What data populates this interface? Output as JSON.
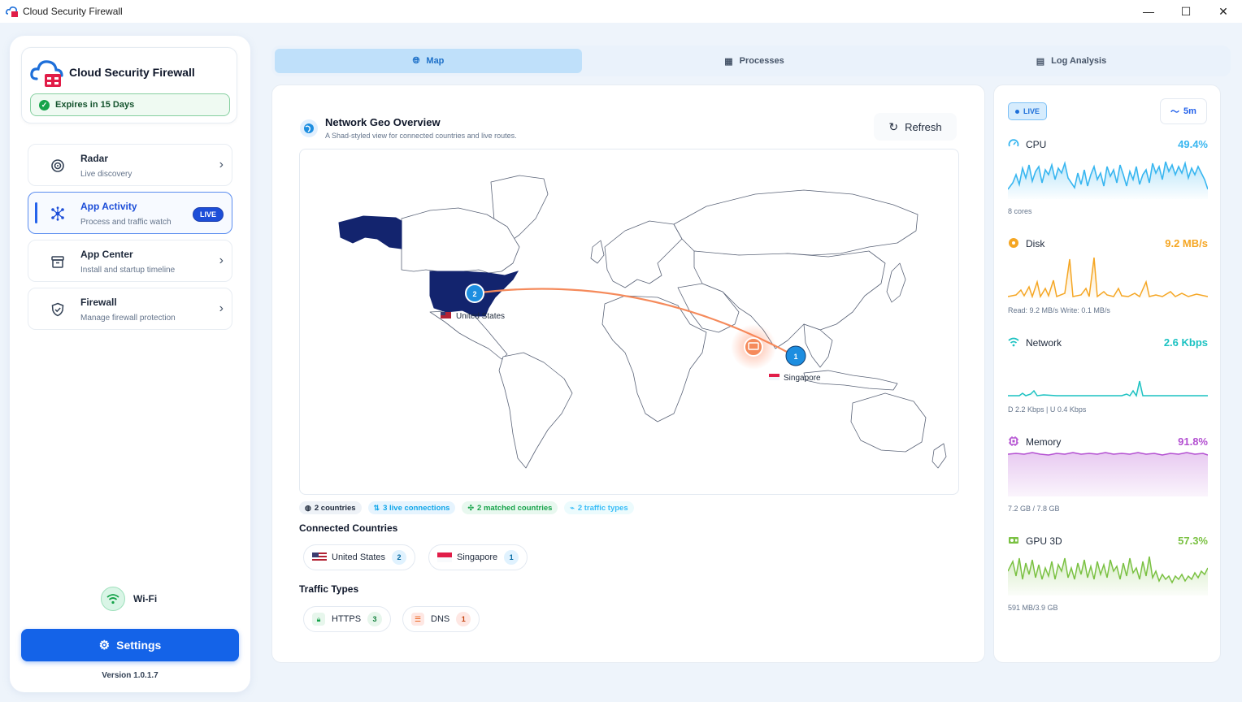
{
  "window": {
    "title": "Cloud Security Firewall",
    "controls": {
      "minimize": "—",
      "maximize": "☐",
      "close": "✕"
    }
  },
  "sidebar": {
    "brand": "Cloud Security Firewall",
    "expires": "Expires in 15 Days",
    "items": [
      {
        "label": "Radar",
        "sub": "Live discovery",
        "icon": "radar-icon"
      },
      {
        "label": "App Activity",
        "sub": "Process and traffic watch",
        "icon": "network-icon",
        "badge": "LIVE"
      },
      {
        "label": "App Center",
        "sub": "Install and startup timeline",
        "icon": "archive-icon"
      },
      {
        "label": "Firewall",
        "sub": "Manage firewall protection",
        "icon": "shield-icon"
      }
    ],
    "wifi_label": "Wi-Fi",
    "settings_label": "Settings",
    "version": "Version 1.0.1.7"
  },
  "tabs": [
    {
      "label": "Map",
      "icon": "globe-icon",
      "active": true
    },
    {
      "label": "Processes",
      "icon": "grid-icon",
      "active": false
    },
    {
      "label": "Log Analysis",
      "icon": "log-icon",
      "active": false
    }
  ],
  "main": {
    "title": "Network Geo Overview",
    "subtitle": "A Shad-styled view for connected countries and live routes.",
    "refresh_label": "Refresh",
    "map": {
      "markers": [
        {
          "label": "United States",
          "count": "2"
        },
        {
          "label": "Singapore",
          "count": "1"
        }
      ]
    },
    "stats": {
      "countries": "2 countries",
      "connections": "3 live connections",
      "matched": "2 matched countries",
      "traffic_types": "2 traffic types"
    },
    "connected_countries_label": "Connected Countries",
    "countries": [
      {
        "name": "United States",
        "count": "2"
      },
      {
        "name": "Singapore",
        "count": "1"
      }
    ],
    "traffic_types_label": "Traffic Types",
    "traffic_types": [
      {
        "name": "HTTPS",
        "count": "3"
      },
      {
        "name": "DNS",
        "count": "1"
      }
    ]
  },
  "metrics_panel": {
    "live_label": "LIVE",
    "range_label": "5m",
    "metrics": [
      {
        "name": "CPU",
        "value": "49.4%",
        "foot": "8 cores",
        "color": "#38b6f0",
        "icon": "gauge-icon"
      },
      {
        "name": "Disk",
        "value": "9.2 MB/s",
        "foot": "Read: 9.2 MB/s  Write: 0.1 MB/s",
        "color": "#f5a623",
        "icon": "disk-icon"
      },
      {
        "name": "Network",
        "value": "2.6 Kbps",
        "foot": "D 2.2 Kbps | U 0.4 Kbps",
        "color": "#1cc2c2",
        "icon": "wifi-icon"
      },
      {
        "name": "Memory",
        "value": "91.8%",
        "foot": "7.2 GB / 7.8 GB",
        "color": "#b34fd1",
        "icon": "chip-icon"
      },
      {
        "name": "GPU 3D",
        "value": "57.3%",
        "foot": "591 MB/3.9 GB",
        "color": "#7ac142",
        "icon": "gpu-icon"
      }
    ]
  }
}
